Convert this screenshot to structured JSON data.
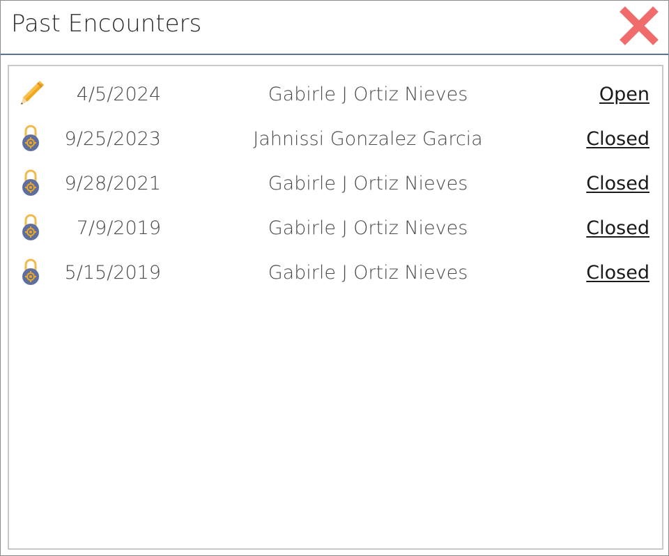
{
  "window": {
    "title": "Past Encounters",
    "close_icon": "close-x-icon",
    "accent_color": "#5a7390",
    "close_color": "#f06b6b"
  },
  "encounters": [
    {
      "icon": "pencil-icon",
      "date": "4/5/2024",
      "provider": "Gabirle J Ortiz Nieves",
      "status": "Open"
    },
    {
      "icon": "lock-icon",
      "date": "9/25/2023",
      "provider": "Jahnissi Gonzalez Garcia",
      "status": "Closed"
    },
    {
      "icon": "lock-icon",
      "date": "9/28/2021",
      "provider": "Gabirle J Ortiz Nieves",
      "status": "Closed"
    },
    {
      "icon": "lock-icon",
      "date": "7/9/2019",
      "provider": "Gabirle J Ortiz Nieves",
      "status": "Closed"
    },
    {
      "icon": "lock-icon",
      "date": "5/15/2019",
      "provider": "Gabirle J Ortiz Nieves",
      "status": "Closed"
    }
  ]
}
